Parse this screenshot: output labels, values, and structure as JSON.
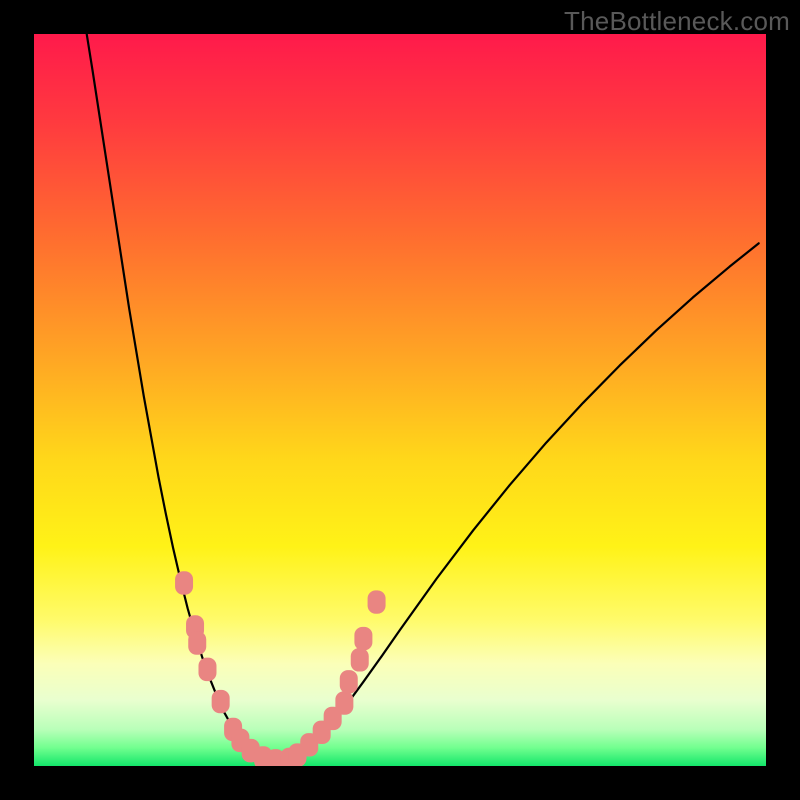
{
  "watermark": {
    "text": "TheBottleneck.com"
  },
  "gradient": {
    "stops": [
      {
        "offset": 0.0,
        "color": "#ff1a4b"
      },
      {
        "offset": 0.12,
        "color": "#ff3a3f"
      },
      {
        "offset": 0.28,
        "color": "#ff6e2f"
      },
      {
        "offset": 0.44,
        "color": "#ffa524"
      },
      {
        "offset": 0.58,
        "color": "#ffd71a"
      },
      {
        "offset": 0.7,
        "color": "#fff217"
      },
      {
        "offset": 0.8,
        "color": "#fffb6a"
      },
      {
        "offset": 0.86,
        "color": "#fbffb8"
      },
      {
        "offset": 0.91,
        "color": "#e9ffcf"
      },
      {
        "offset": 0.95,
        "color": "#b9ffb9"
      },
      {
        "offset": 0.975,
        "color": "#72ff8f"
      },
      {
        "offset": 1.0,
        "color": "#13e66a"
      }
    ]
  },
  "chart_data": {
    "type": "line",
    "title": "",
    "xlabel": "",
    "ylabel": "",
    "xlim": [
      0,
      100
    ],
    "ylim": [
      0,
      100
    ],
    "series": [
      {
        "name": "curve",
        "x": [
          7.2,
          8.0,
          9.0,
          10.0,
          11.0,
          12.0,
          13.0,
          14.0,
          15.0,
          16.0,
          17.0,
          18.0,
          19.0,
          20.0,
          21.0,
          22.0,
          23.0,
          24.0,
          25.0,
          26.0,
          27.0,
          28.0,
          29.0,
          30.0,
          31.5,
          33.0,
          34.5,
          36.0,
          37.5,
          40.0,
          42.5,
          45.0,
          47.5,
          50.0,
          55.0,
          60.0,
          65.0,
          70.0,
          75.0,
          80.0,
          85.0,
          90.0,
          95.0,
          99.0
        ],
        "y": [
          100.0,
          95.0,
          88.5,
          82.0,
          75.5,
          69.0,
          62.5,
          56.5,
          50.5,
          45.0,
          39.5,
          34.5,
          29.8,
          25.5,
          21.5,
          18.0,
          14.8,
          12.0,
          9.5,
          7.3,
          5.5,
          4.0,
          2.7,
          1.8,
          1.0,
          0.6,
          0.7,
          1.3,
          2.4,
          5.0,
          8.1,
          11.5,
          15.0,
          18.6,
          25.6,
          32.2,
          38.4,
          44.2,
          49.6,
          54.7,
          59.5,
          64.0,
          68.2,
          71.4
        ]
      }
    ],
    "markers": {
      "name": "pink-markers",
      "points": [
        {
          "x": 20.5,
          "y": 25.0
        },
        {
          "x": 22.0,
          "y": 19.0
        },
        {
          "x": 22.3,
          "y": 16.8
        },
        {
          "x": 23.7,
          "y": 13.2
        },
        {
          "x": 25.5,
          "y": 8.8
        },
        {
          "x": 27.2,
          "y": 5.0
        },
        {
          "x": 28.2,
          "y": 3.5
        },
        {
          "x": 29.6,
          "y": 2.1
        },
        {
          "x": 31.3,
          "y": 1.1
        },
        {
          "x": 33.0,
          "y": 0.7
        },
        {
          "x": 34.9,
          "y": 0.9
        },
        {
          "x": 36.0,
          "y": 1.5
        },
        {
          "x": 37.6,
          "y": 2.9
        },
        {
          "x": 39.3,
          "y": 4.6
        },
        {
          "x": 40.8,
          "y": 6.5
        },
        {
          "x": 42.4,
          "y": 8.6
        },
        {
          "x": 43.0,
          "y": 11.5
        },
        {
          "x": 44.5,
          "y": 14.5
        },
        {
          "x": 45.0,
          "y": 17.4
        },
        {
          "x": 46.8,
          "y": 22.4
        }
      ],
      "radius": 9,
      "color": "#e98582"
    }
  }
}
